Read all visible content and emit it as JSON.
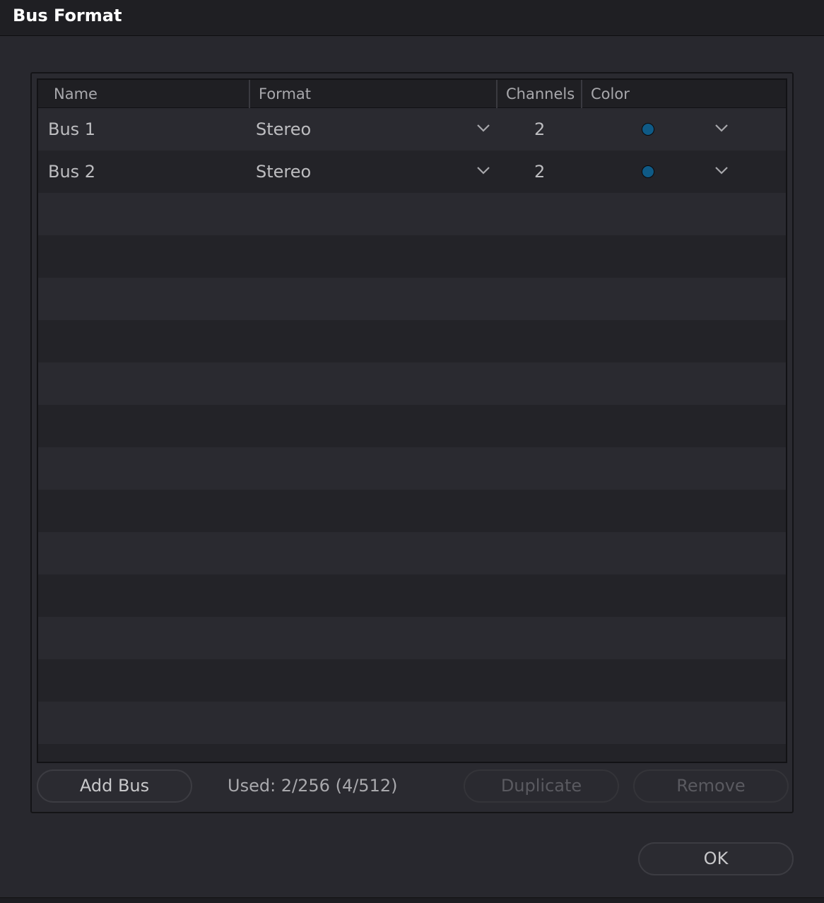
{
  "window": {
    "title": "Bus Format"
  },
  "table": {
    "columns": [
      "Name",
      "Format",
      "Channels",
      "Color"
    ],
    "rows": [
      {
        "name": "Bus 1",
        "format": "Stereo",
        "channels": "2",
        "color": "#0f5a86"
      },
      {
        "name": "Bus 2",
        "format": "Stereo",
        "channels": "2",
        "color": "#0f5a86"
      }
    ]
  },
  "footer": {
    "add_bus_label": "Add Bus",
    "used_text": "Used: 2/256  (4/512)",
    "duplicate_label": "Duplicate",
    "remove_label": "Remove"
  },
  "dialog": {
    "ok_label": "OK"
  },
  "icons": {
    "dropdown": "chevron-down-icon",
    "color_swatch": "color-dot-icon"
  }
}
